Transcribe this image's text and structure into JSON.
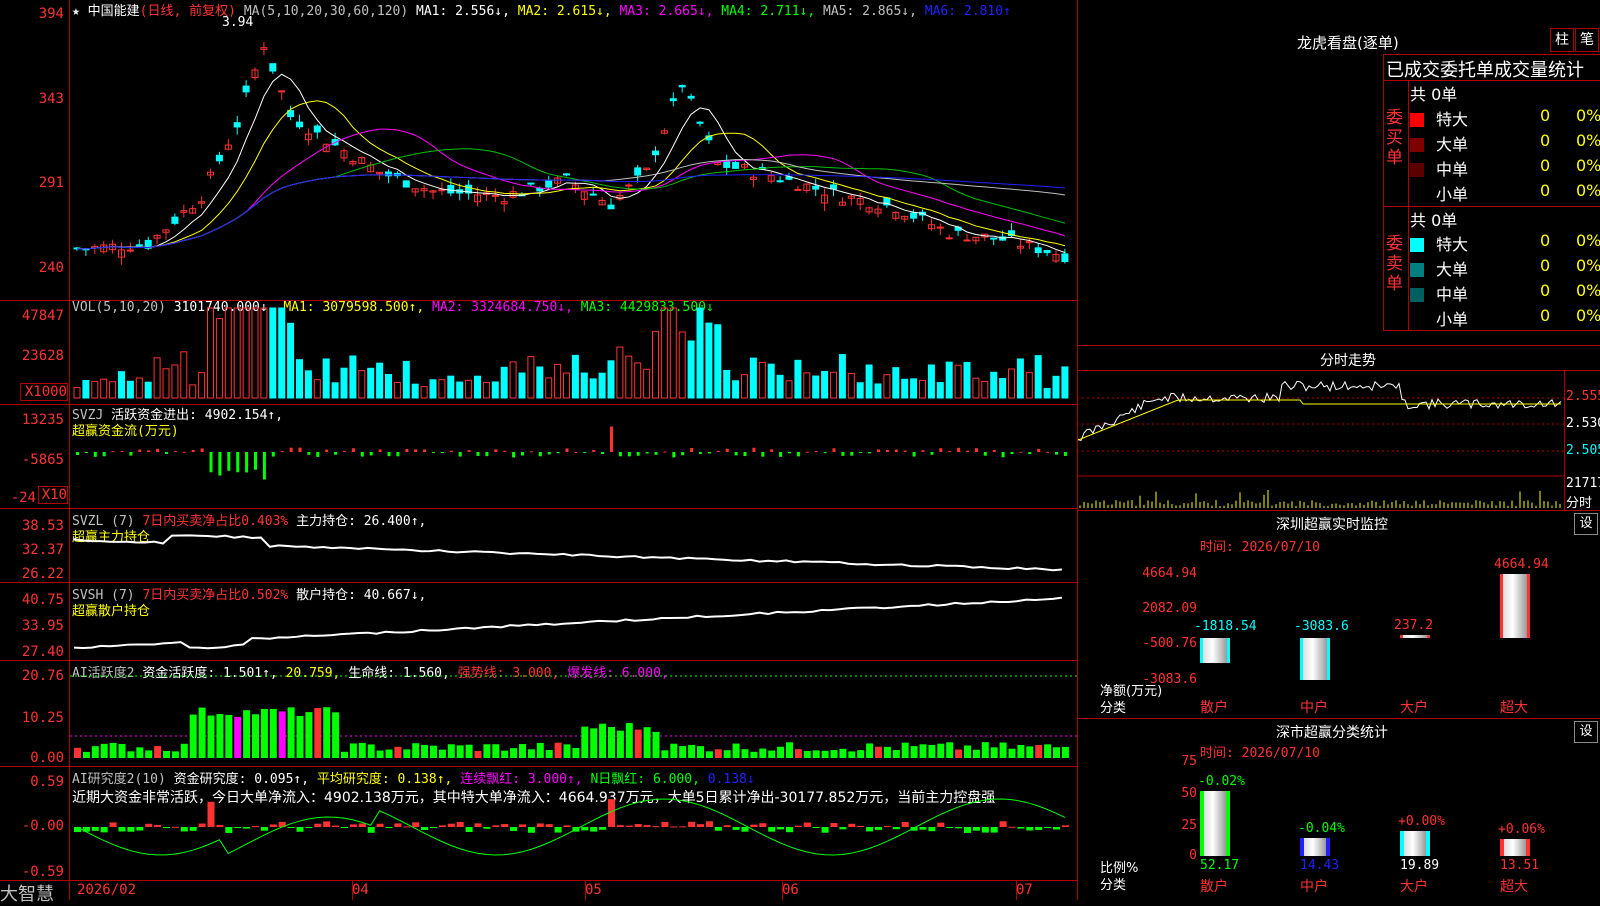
{
  "header": {
    "star": "★ ",
    "stock_name": "中国能建",
    "period": "(日线, 前复权)",
    "ma_label": "MA(5,10,20,30,60,120)",
    "ma1": "MA1: 2.556↓,",
    "ma2": "MA2: 2.615↓,",
    "ma3": "MA3: 2.665↓,",
    "ma4": "MA4: 2.711↓,",
    "ma5": "MA5: 2.865↓,",
    "ma6": "MA6: 2.810↑",
    "peak_label": "3.94"
  },
  "price_axis": [
    "394",
    "343",
    "291",
    "240"
  ],
  "vol_pane": {
    "axis": [
      "47847",
      "23628",
      "X1000"
    ],
    "label": "VOL(5,10,20)",
    "value": "3101740.000↓,",
    "ma1": "MA1: 3079598.500↑,",
    "ma2": "MA2: 3324684.750↓,",
    "ma3": "MA3: 4429833.500↓"
  },
  "svzj_pane": {
    "axis": [
      "13235",
      "-5865",
      "-24",
      "X10"
    ],
    "label": "SVZJ",
    "value": "活跃资金进出: 4902.154↑,",
    "subtitle": "超赢资金流(万元)"
  },
  "svzl_pane": {
    "axis": [
      "38.53",
      "32.37",
      "26.22"
    ],
    "label": "SVZL (7)",
    "ratio": "7日内买卖净占比0.403%",
    "hold": "主力持仓: 26.400↑,",
    "subtitle": "超赢主力持仓"
  },
  "svsh_pane": {
    "axis": [
      "40.75",
      "33.95",
      "27.40"
    ],
    "label": "SVSH (7)",
    "ratio": "7日内买卖净占比0.502%",
    "hold": "散户持仓: 40.667↓,",
    "subtitle": "超赢散户持仓"
  },
  "ai_active_pane": {
    "axis": [
      "20.76",
      "10.25",
      "0.00"
    ],
    "label": "AI活跃度2",
    "value": "资金活跃度: 1.501↑,",
    "v2": "20.759,",
    "life": "生命线: 1.560,",
    "strong": "强势线: 3.000,",
    "burst": "爆发线: 6.000,"
  },
  "ai_research_pane": {
    "axis": [
      "0.59",
      "-0.00",
      "-0.59"
    ],
    "label": "AI研究度2(10)",
    "value": "资金研究度: 0.095↑,",
    "avg": "平均研究度: 0.138↑,",
    "red": "连续飘红: 3.000↑,",
    "nred": "N日飘红: 6.000,",
    "last": "0.138↓",
    "comment": "近期大资金非常活跃，今日大单净流入：4902.138万元，其中特大单净流入：4664.937万元，大单5日累计净出-30177.852万元，当前主力控盘强"
  },
  "date_axis": [
    "2026/02",
    "04",
    "05",
    "06",
    "07"
  ],
  "brand": "大智慧",
  "right": {
    "title": "龙虎看盘(逐单)",
    "btn_zhu": "柱",
    "btn_bi": "笔",
    "section_title": "已成交委托单成交量统计",
    "buy": {
      "side": "委买单",
      "total": "共 0单",
      "rows": [
        {
          "name": "特大",
          "count": "0",
          "pct": "0%",
          "color": "#ff0000"
        },
        {
          "name": "大单",
          "count": "0",
          "pct": "0%",
          "color": "#800000"
        },
        {
          "name": "中单",
          "count": "0",
          "pct": "0%",
          "color": "#5a0000"
        },
        {
          "name": "小单",
          "count": "0",
          "pct": "0%",
          "color": ""
        }
      ]
    },
    "sell": {
      "side": "委卖单",
      "total": "共 0单",
      "rows": [
        {
          "name": "特大",
          "count": "0",
          "pct": "0%",
          "color": "#00ffff"
        },
        {
          "name": "大单",
          "count": "0",
          "pct": "0%",
          "color": "#008080"
        },
        {
          "name": "中单",
          "count": "0",
          "pct": "0%",
          "color": "#006060"
        },
        {
          "name": "小单",
          "count": "0",
          "pct": "0%",
          "color": ""
        }
      ]
    },
    "intraday": {
      "title": "分时走势",
      "prices": [
        "2.555",
        "2.530",
        "2.505"
      ],
      "vol": "21717",
      "vol_unit": "分时"
    },
    "monitor": {
      "title": "深圳超赢实时监控",
      "time": "时间: 2026/07/10",
      "setting": "设",
      "axis": [
        "4664.94",
        "2082.09",
        "-500.76",
        "-3083.6"
      ],
      "unit": "净额(万元)",
      "category_label": "分类",
      "bars": [
        {
          "name": "散户",
          "value": "-1818.54",
          "v": -1818.54
        },
        {
          "name": "中户",
          "value": "-3083.6",
          "v": -3083.6
        },
        {
          "name": "大户",
          "value": "237.2",
          "v": 237.2
        },
        {
          "name": "超大",
          "value": "4664.94",
          "v": 4664.94
        }
      ]
    },
    "stats": {
      "title": "深市超赢分类统计",
      "time": "时间: 2026/07/10",
      "setting": "设",
      "axis": [
        "75",
        "50",
        "25",
        "0"
      ],
      "unit": "比例%",
      "category_label": "分类",
      "bars": [
        {
          "name": "散户",
          "value": "52.17",
          "change": "-0.02%",
          "v": 52.17
        },
        {
          "name": "中户",
          "value": "14.43",
          "change": "-0.04%",
          "v": 14.43
        },
        {
          "name": "大户",
          "value": "19.89",
          "change": "+0.00%",
          "v": 19.89
        },
        {
          "name": "超大",
          "value": "13.51",
          "change": "+0.06%",
          "v": 13.51
        }
      ]
    }
  }
}
